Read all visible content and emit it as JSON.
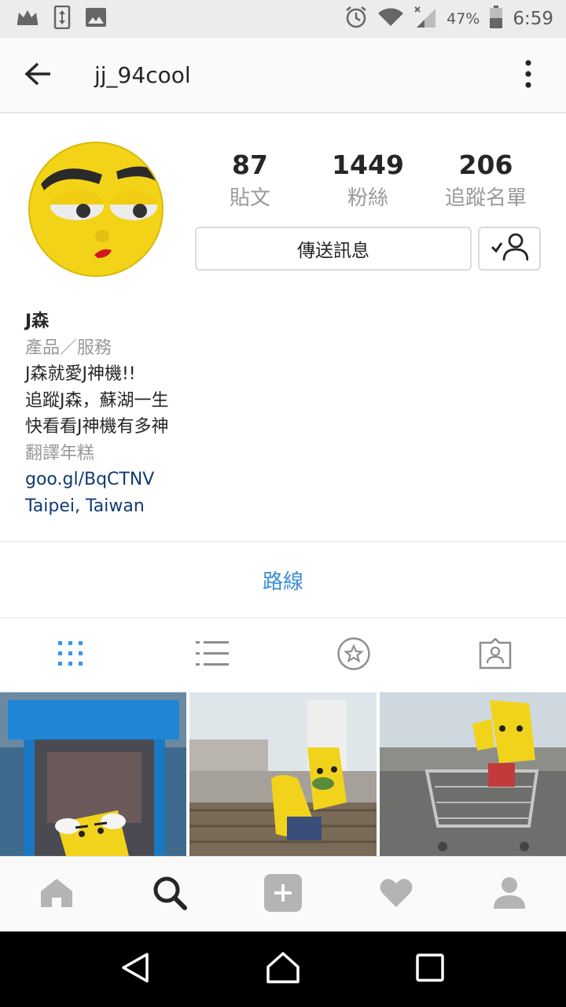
{
  "status_bar": {
    "battery_percent": "47%",
    "time": "6:59",
    "icons": [
      "crown-icon",
      "phone-transfer-icon",
      "image-icon",
      "alarm-icon",
      "wifi-icon",
      "signal-icon",
      "battery-icon"
    ]
  },
  "app_bar": {
    "title": "jj_94cool",
    "icons": [
      "back-arrow-icon",
      "more-vert-icon"
    ]
  },
  "profile": {
    "stats": [
      {
        "count": "87",
        "label": "貼文"
      },
      {
        "count": "1449",
        "label": "粉絲"
      },
      {
        "count": "206",
        "label": "追蹤名單"
      }
    ],
    "message_button": "傳送訊息",
    "follow_icon": "following-check-icon"
  },
  "bio": {
    "name": "J森",
    "category": "產品／服務",
    "lines": [
      "J森就愛J神機!!",
      "追蹤J森，蘇湖一生",
      "快看看J神機有多神"
    ],
    "translate": "翻譯年糕",
    "link": "goo.gl/BqCTNV",
    "location": "Taipei, Taiwan"
  },
  "directions_label": "路線",
  "tabs": [
    "grid-icon",
    "list-icon",
    "star-tag-icon",
    "tagged-photos-icon"
  ],
  "bottom_nav": [
    "home-icon",
    "search-icon",
    "add-icon",
    "heart-icon",
    "profile-icon"
  ],
  "system_nav": [
    "back-icon",
    "home-icon",
    "recents-icon"
  ],
  "colors": {
    "link": "#3b8dd8",
    "bio_link": "#0f3b73",
    "secondary_text": "#999999",
    "avatar_yellow": "#f3d318"
  }
}
